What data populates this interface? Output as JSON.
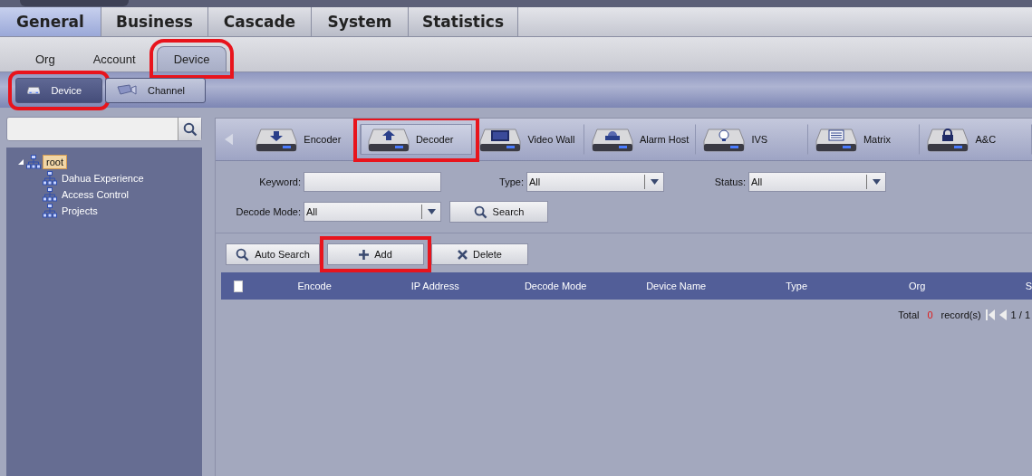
{
  "main_tabs": [
    {
      "label": "General",
      "selected": true
    },
    {
      "label": "Business",
      "selected": false
    },
    {
      "label": "Cascade",
      "selected": false
    },
    {
      "label": "System",
      "selected": false
    },
    {
      "label": "Statistics",
      "selected": false
    }
  ],
  "sub_tabs": [
    {
      "label": "Org",
      "selected": false,
      "highlighted": false
    },
    {
      "label": "Account",
      "selected": false,
      "highlighted": false
    },
    {
      "label": "Device",
      "selected": true,
      "highlighted": true
    }
  ],
  "view_buttons": [
    {
      "label": "Device",
      "kind": "device",
      "selected": true,
      "highlighted": true
    },
    {
      "label": "Channel",
      "kind": "camera",
      "selected": false,
      "highlighted": false
    }
  ],
  "org_tree": [
    {
      "label": "root",
      "selected": true,
      "expanded": true,
      "children": [
        {
          "label": "Dahua Experience",
          "selected": false
        },
        {
          "label": "Access Control",
          "selected": false
        },
        {
          "label": "Projects",
          "selected": false
        }
      ]
    }
  ],
  "device_types": [
    {
      "label": "Encoder",
      "kind": "encoder",
      "selected": false,
      "highlighted": false
    },
    {
      "label": "Decoder",
      "kind": "decoder",
      "selected": true,
      "highlighted": true
    },
    {
      "label": "Video Wall",
      "kind": "videowall",
      "selected": false,
      "highlighted": false
    },
    {
      "label": "Alarm Host",
      "kind": "alarm",
      "selected": false,
      "highlighted": false
    },
    {
      "label": "IVS",
      "kind": "ivs",
      "selected": false,
      "highlighted": false
    },
    {
      "label": "Matrix",
      "kind": "matrix",
      "selected": false,
      "highlighted": false
    },
    {
      "label": "A&C",
      "kind": "lock",
      "selected": false,
      "highlighted": false
    }
  ],
  "filters": [
    {
      "label": "Keyword:",
      "kind": "text"
    },
    {
      "label": "Type:",
      "kind": "select",
      "value": "All"
    },
    {
      "label": "Status:",
      "kind": "select",
      "value": "All"
    },
    {
      "label": "Decode Mode:",
      "kind": "select",
      "value": "All"
    }
  ],
  "search_button": "Search",
  "actions": [
    {
      "label": "Auto Search",
      "kind": "search",
      "highlighted": false
    },
    {
      "label": "Add",
      "kind": "add",
      "highlighted": true
    },
    {
      "label": "Delete",
      "kind": "delete",
      "highlighted": false
    }
  ],
  "table": {
    "select_all": false,
    "columns": [
      "Encode",
      "IP Address",
      "Decode Mode",
      "Device Name",
      "Type",
      "Org",
      "S"
    ]
  },
  "pager": {
    "total_label": "Total",
    "count": "0",
    "unit": "record(s)",
    "page": "1 / 1"
  }
}
